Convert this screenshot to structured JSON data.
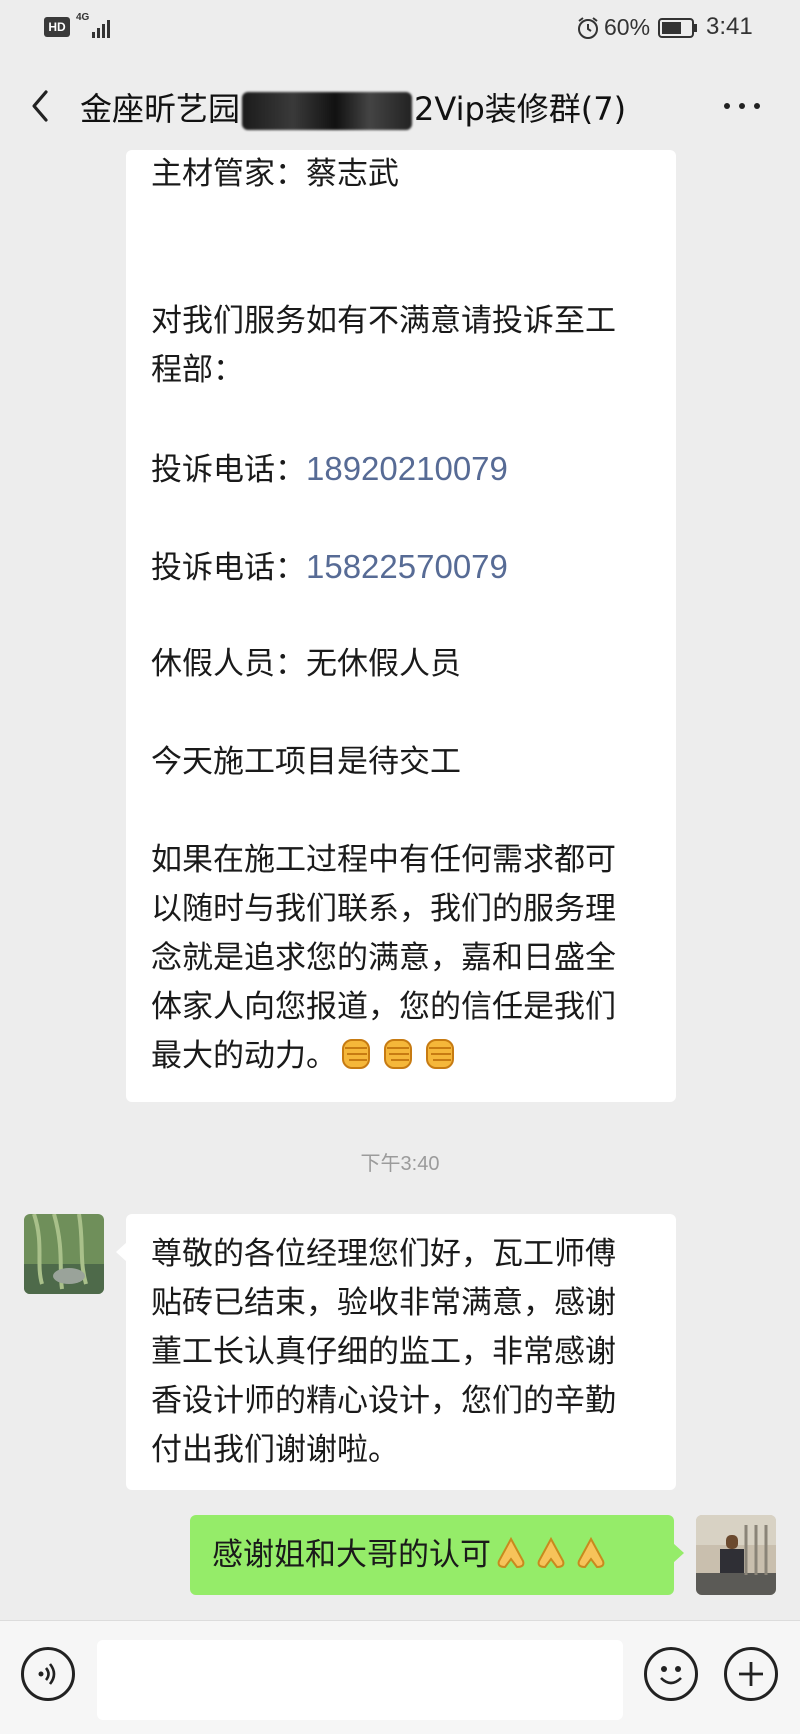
{
  "status_bar": {
    "hd": "HD",
    "network": "4G",
    "battery_percent": "60%",
    "time": "3:41",
    "icons": [
      "alarm-icon",
      "battery-icon",
      "signal-icon"
    ]
  },
  "header": {
    "title_prefix": "金座昕艺园",
    "title_suffix": "2Vip装修群(7)",
    "icons": [
      "back-arrow-icon",
      "more-dots-icon"
    ]
  },
  "messages": {
    "first": {
      "lines": [
        "主材管家：蔡志武",
        "",
        "",
        "对我们服务如有不满意请投诉至工",
        "程部：",
        "",
        "",
        "",
        "休假人员：无休假人员",
        "",
        "今天施工项目是待交工",
        "",
        "如果在施工过程中有任何需求都可",
        "以随时与我们联系，我们的服务理",
        "念就是追求您的满意，嘉和日盛全",
        "体家人向您报道，您的信任是我们"
      ],
      "phone_label": "投诉电话：",
      "phone1": "18920210079",
      "phone2": "15822570079",
      "last_line": "最大的动力。",
      "emoji": "fist-emoji"
    },
    "timestamp": "下午3:40",
    "second": {
      "lines": [
        "尊敬的各位经理您们好，瓦工师傅",
        "贴砖已结束，验收非常满意，感谢",
        "董工长认真仔细的监工，非常感谢",
        "香设计师的精心设计，您们的辛勤",
        "付出我们谢谢啦。"
      ]
    },
    "mine": {
      "text": "感谢姐和大哥的认可",
      "emoji": "folded-hands-emoji"
    }
  },
  "input_bar": {
    "placeholder": "",
    "icons": [
      "voice-icon",
      "emoji-icon",
      "plus-icon"
    ]
  },
  "colors": {
    "background": "#ededed",
    "bubble_mine": "#95ec69",
    "link": "#576b95"
  }
}
